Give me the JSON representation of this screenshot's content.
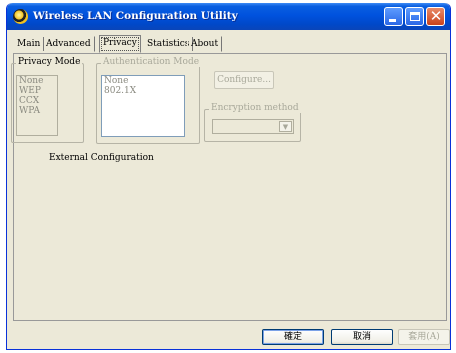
{
  "window": {
    "title": "Wireless LAN Configuration Utility"
  },
  "tabs": [
    {
      "label": "Main"
    },
    {
      "label": "Advanced"
    },
    {
      "label": "Privacy",
      "active": true
    },
    {
      "label": "Statistics"
    },
    {
      "label": "About"
    }
  ],
  "privacy_mode": {
    "label": "Privacy Mode",
    "items": [
      "None",
      "WEP",
      "CCX",
      "WPA"
    ]
  },
  "authentication_mode": {
    "label": "Authentication Mode",
    "items": [
      "None",
      "802.1X"
    ]
  },
  "configure_label": "Configure...",
  "encryption_method": {
    "label": "Encryption method",
    "value": ""
  },
  "external_configuration_label": "External Configuration",
  "buttons": {
    "ok": "確定",
    "cancel": "取消",
    "apply": "套用(A)"
  },
  "colors": {
    "titlebar": "#0052de",
    "face": "#ece9d8",
    "close": "#c9431c"
  }
}
